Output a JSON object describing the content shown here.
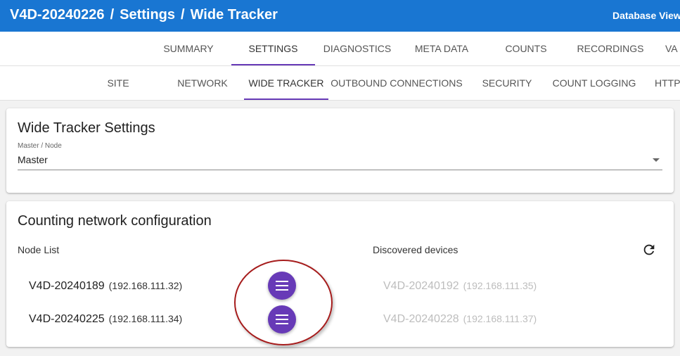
{
  "header": {
    "breadcrumb": [
      "V4D-20240226",
      "Settings",
      "Wide Tracker"
    ],
    "separator": "/",
    "database_view": "Database View",
    "background_color": "#1976d2"
  },
  "main_tabs": [
    {
      "label": "SUMMARY",
      "active": false
    },
    {
      "label": "SETTINGS",
      "active": true
    },
    {
      "label": "DIAGNOSTICS",
      "active": false
    },
    {
      "label": "META DATA",
      "active": false
    },
    {
      "label": "COUNTS",
      "active": false
    },
    {
      "label": "RECORDINGS",
      "active": false
    },
    {
      "label": "VA",
      "active": false
    }
  ],
  "settings_tabs": [
    {
      "label": "SITE",
      "active": false
    },
    {
      "label": "NETWORK",
      "active": false
    },
    {
      "label": "WIDE TRACKER",
      "active": true
    },
    {
      "label": "OUTBOUND CONNECTIONS",
      "active": false
    },
    {
      "label": "SECURITY",
      "active": false
    },
    {
      "label": "COUNT LOGGING",
      "active": false
    },
    {
      "label": "HTTP",
      "active": false
    }
  ],
  "tab_indicator_color": "#673ab7",
  "wide_tracker_settings": {
    "title": "Wide Tracker Settings",
    "field_label": "Master / Node",
    "field_value": "Master"
  },
  "counting_network": {
    "title": "Counting network configuration",
    "node_list_label": "Node List",
    "discovered_label": "Discovered devices",
    "refresh_icon": "refresh-icon",
    "nodes": [
      {
        "name": "V4D-20240189",
        "ip": "(192.168.111.32)"
      },
      {
        "name": "V4D-20240225",
        "ip": "(192.168.111.34)"
      }
    ],
    "discovered": [
      {
        "name": "V4D-20240192",
        "ip": "(192.168.111.35)"
      },
      {
        "name": "V4D-20240228",
        "ip": "(192.168.111.37)"
      }
    ],
    "menu_button_icon": "menu-icon",
    "menu_button_color": "#673ab7",
    "highlight_color": "#a61c1c"
  }
}
